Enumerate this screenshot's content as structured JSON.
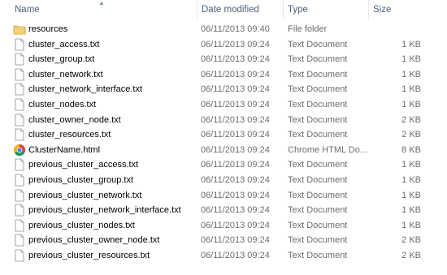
{
  "columns": {
    "name": "Name",
    "date_modified": "Date modified",
    "type": "Type",
    "size": "Size"
  },
  "colors": {
    "header_text": "#4c607a",
    "secondary_text": "#6d6d6d",
    "folder": "#e8c25a"
  },
  "files": [
    {
      "name": "resources",
      "date": "06/11/2013 09:40",
      "type": "File folder",
      "size": "",
      "icon": "folder-icon"
    },
    {
      "name": "cluster_access.txt",
      "date": "06/11/2013 09:24",
      "type": "Text Document",
      "size": "1 KB",
      "icon": "text-file-icon"
    },
    {
      "name": "cluster_group.txt",
      "date": "06/11/2013 09:24",
      "type": "Text Document",
      "size": "1 KB",
      "icon": "text-file-icon"
    },
    {
      "name": "cluster_network.txt",
      "date": "06/11/2013 09:24",
      "type": "Text Document",
      "size": "1 KB",
      "icon": "text-file-icon"
    },
    {
      "name": "cluster_network_interface.txt",
      "date": "06/11/2013 09:24",
      "type": "Text Document",
      "size": "1 KB",
      "icon": "text-file-icon"
    },
    {
      "name": "cluster_nodes.txt",
      "date": "06/11/2013 09:24",
      "type": "Text Document",
      "size": "1 KB",
      "icon": "text-file-icon"
    },
    {
      "name": "cluster_owner_node.txt",
      "date": "06/11/2013 09:24",
      "type": "Text Document",
      "size": "2 KB",
      "icon": "text-file-icon"
    },
    {
      "name": "cluster_resources.txt",
      "date": "06/11/2013 09:24",
      "type": "Text Document",
      "size": "2 KB",
      "icon": "text-file-icon"
    },
    {
      "name": "ClusterName.html",
      "date": "06/11/2013 09:24",
      "type": "Chrome HTML Do...",
      "size": "8 KB",
      "icon": "chrome-icon"
    },
    {
      "name": "previous_cluster_access.txt",
      "date": "06/11/2013 09:24",
      "type": "Text Document",
      "size": "1 KB",
      "icon": "text-file-icon"
    },
    {
      "name": "previous_cluster_group.txt",
      "date": "06/11/2013 09:24",
      "type": "Text Document",
      "size": "1 KB",
      "icon": "text-file-icon"
    },
    {
      "name": "previous_cluster_network.txt",
      "date": "06/11/2013 09:24",
      "type": "Text Document",
      "size": "1 KB",
      "icon": "text-file-icon"
    },
    {
      "name": "previous_cluster_network_interface.txt",
      "date": "06/11/2013 09:24",
      "type": "Text Document",
      "size": "1 KB",
      "icon": "text-file-icon"
    },
    {
      "name": "previous_cluster_nodes.txt",
      "date": "06/11/2013 09:24",
      "type": "Text Document",
      "size": "1 KB",
      "icon": "text-file-icon"
    },
    {
      "name": "previous_cluster_owner_node.txt",
      "date": "06/11/2013 09:24",
      "type": "Text Document",
      "size": "2 KB",
      "icon": "text-file-icon"
    },
    {
      "name": "previous_cluster_resources.txt",
      "date": "06/11/2013 09:24",
      "type": "Text Document",
      "size": "2 KB",
      "icon": "text-file-icon"
    }
  ]
}
